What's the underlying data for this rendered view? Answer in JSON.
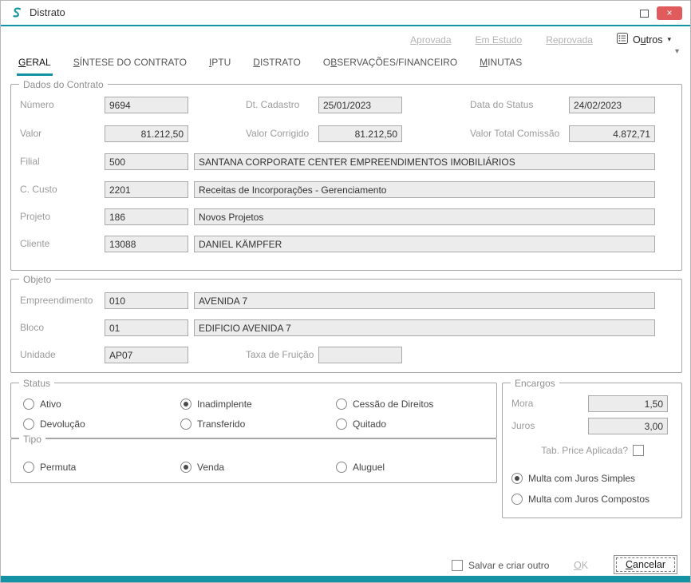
{
  "window": {
    "title": "Distrato",
    "accent_color": "#1593a5",
    "close_button_color": "#e05c5c",
    "close_glyph": "×"
  },
  "actions": {
    "status_links": [
      "Aprovada",
      "Em Estudo",
      "Reprovada"
    ],
    "outros": {
      "pre": "O",
      "accel": "u",
      "rest": "tros",
      "caret": "▾"
    }
  },
  "tabs": [
    {
      "pre": "",
      "accel": "G",
      "rest": "ERAL",
      "active": true
    },
    {
      "pre": "",
      "accel": "S",
      "rest": "ÍNTESE DO CONTRATO",
      "active": false
    },
    {
      "pre": "",
      "accel": "I",
      "rest": "PTU",
      "active": false
    },
    {
      "pre": "",
      "accel": "D",
      "rest": "ISTRATO",
      "active": false
    },
    {
      "pre": "O",
      "accel": "B",
      "rest": "SERVAÇÕES/FINANCEIRO",
      "active": false
    },
    {
      "pre": "",
      "accel": "M",
      "rest": "INUTAS",
      "active": false
    }
  ],
  "tab_overflow_caret": "▾",
  "dados_contrato": {
    "legend": "Dados do Contrato",
    "numero": {
      "label": "Número",
      "value": "9694"
    },
    "dt_cadastro": {
      "label": "Dt. Cadastro",
      "value": "25/01/2023"
    },
    "data_status": {
      "label": "Data do Status",
      "value": "24/02/2023"
    },
    "valor": {
      "label": "Valor",
      "value": "81.212,50"
    },
    "valor_corrigido": {
      "label": "Valor Corrigido",
      "value": "81.212,50"
    },
    "valor_total_comissao": {
      "label": "Valor Total Comissão",
      "value": "4.872,71"
    },
    "filial": {
      "label": "Filial",
      "code": "500",
      "desc": "SANTANA CORPORATE CENTER EMPREENDIMENTOS IMOBILIÁRIOS"
    },
    "c_custo": {
      "label": "C. Custo",
      "code": "2201",
      "desc": "Receitas de Incorporações - Gerenciamento"
    },
    "projeto": {
      "label": "Projeto",
      "code": "186",
      "desc": "Novos Projetos"
    },
    "cliente": {
      "label": "Cliente",
      "code": "13088",
      "desc": "DANIEL KÄMPFER"
    }
  },
  "objeto": {
    "legend": "Objeto",
    "empreendimento": {
      "label": "Empreendimento",
      "code": "010",
      "desc": "AVENIDA 7"
    },
    "bloco": {
      "label": "Bloco",
      "code": "01",
      "desc": "EDIFICIO AVENIDA 7"
    },
    "unidade": {
      "label": "Unidade",
      "code": "AP07"
    },
    "taxa_fruicao": {
      "label": "Taxa de Fruição",
      "value": ""
    }
  },
  "status_group": {
    "legend": "Status",
    "options": [
      {
        "label": "Ativo",
        "selected": false
      },
      {
        "label": "Inadimplente",
        "selected": true
      },
      {
        "label": "Cessão de Direitos",
        "selected": false
      },
      {
        "label": "Devolução",
        "selected": false
      },
      {
        "label": "Transferido",
        "selected": false
      },
      {
        "label": "Quitado",
        "selected": false
      }
    ]
  },
  "tipo_group": {
    "legend": "Tipo",
    "options": [
      {
        "label": "Permuta",
        "selected": false
      },
      {
        "label": "Venda",
        "selected": true
      },
      {
        "label": "Aluguel",
        "selected": false
      }
    ]
  },
  "encargos": {
    "legend": "Encargos",
    "mora": {
      "label": "Mora",
      "value": "1,50"
    },
    "juros": {
      "label": "Juros",
      "value": "3,00"
    },
    "tab_price": {
      "label": "Tab. Price Aplicada?",
      "checked": false
    },
    "multa_options": [
      {
        "label": "Multa com Juros Simples",
        "selected": true
      },
      {
        "label": "Multa com Juros Compostos",
        "selected": false
      }
    ]
  },
  "footer": {
    "salvar_criar_outro": {
      "label": "Salvar e criar outro",
      "checked": false
    },
    "ok": {
      "pre": "",
      "accel": "O",
      "rest": "K"
    },
    "cancelar": {
      "pre": "",
      "accel": "C",
      "rest": "ancelar"
    }
  }
}
